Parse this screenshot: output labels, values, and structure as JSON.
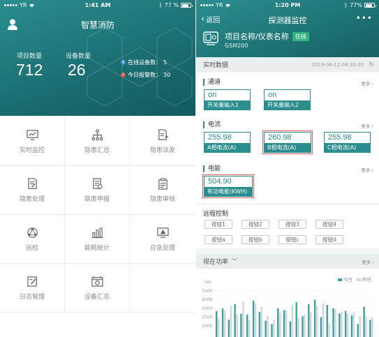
{
  "left": {
    "status": {
      "carrier": "YR",
      "time": "1:41 AM",
      "battery": "77 %"
    },
    "title": "智慧消防",
    "stats": [
      {
        "label": "项目数量",
        "value": "712"
      },
      {
        "label": "设备数量",
        "value": "26"
      }
    ],
    "mini_stats": [
      {
        "label": "在线设备数：",
        "value": "5",
        "color": "#3f8ddf"
      },
      {
        "label": "今日报警数：",
        "value": "30",
        "color": "#e2504a"
      }
    ],
    "grid": [
      {
        "label": "实时监控",
        "icon": "monitor-chart-icon"
      },
      {
        "label": "隐患汇总",
        "icon": "hierarchy-icon"
      },
      {
        "label": "隐患派发",
        "icon": "dispatch-doc-icon"
      },
      {
        "label": "隐患处理",
        "icon": "edit-doc-icon"
      },
      {
        "label": "隐患申报",
        "icon": "report-doc-icon"
      },
      {
        "label": "隐患审核",
        "icon": "clipboard-icon"
      },
      {
        "label": "巡检",
        "icon": "patrol-icon"
      },
      {
        "label": "能耗统计",
        "icon": "bar-stats-icon"
      },
      {
        "label": "应急处理",
        "icon": "emergency-monitor-icon"
      },
      {
        "label": "日志管理",
        "icon": "log-icon"
      },
      {
        "label": "设备汇总",
        "icon": "device-summary-icon"
      }
    ]
  },
  "right": {
    "status": {
      "carrier": "YR",
      "time": "1:20 PM",
      "battery": "77%"
    },
    "back": "返回",
    "title": "探测器监控",
    "project": "项目名称/仪表名称",
    "online": "在线",
    "model": "GSM200",
    "realtime": {
      "label": "实时数据",
      "timestamp": "2019-08-12 08:30:03"
    },
    "more": "更多",
    "channel": {
      "title": "通道",
      "items": [
        {
          "value": "on",
          "name": "开关量输入1"
        },
        {
          "value": "on",
          "name": "开关量输入2"
        }
      ]
    },
    "current": {
      "title": "电流",
      "items": [
        {
          "value": "255.98",
          "name": "A相电流(A)"
        },
        {
          "value": "260.98",
          "name": "B相电流(A)"
        },
        {
          "value": "255.98",
          "name": "C相电流(A)"
        }
      ]
    },
    "energy": {
      "title": "电能",
      "items": [
        {
          "value": "504.90",
          "name": "有功电能(KWH)"
        }
      ]
    },
    "remote": {
      "title": "远程控制",
      "buttons": [
        "按钮1",
        "按钮2",
        "按钮3",
        "按钮4",
        "按钮a",
        "按钮b",
        "按钮c",
        "按钮d"
      ]
    },
    "power": {
      "label": "视在功率"
    }
  },
  "chart_data": {
    "type": "bar",
    "title": "",
    "ylabel": "(w)",
    "ylim": [
      0,
      5000
    ],
    "yticks": [
      "5000",
      "4000",
      "3000",
      "2000",
      "1000"
    ],
    "series": [
      {
        "name": "今日",
        "color": "#3aa1a1",
        "values": [
          2700,
          3000,
          1700,
          3500,
          2400,
          2300,
          3900,
          2600,
          1600,
          1200,
          3000,
          2800,
          1500,
          3700,
          2100,
          3500,
          4000,
          2000,
          3400,
          3000,
          2400,
          2700,
          2200,
          1200,
          3200,
          1700
        ]
      },
      {
        "name": "昨日",
        "color": "#cfd6d8",
        "values": [
          1800,
          2800,
          3300,
          2300,
          3800,
          1700,
          3600,
          3200,
          2100,
          1700,
          2500,
          2800,
          3400,
          1900,
          2300,
          2600,
          3300,
          3600,
          1300,
          2900,
          2600,
          2400,
          2600,
          2100,
          2100,
          2000
        ]
      }
    ]
  }
}
